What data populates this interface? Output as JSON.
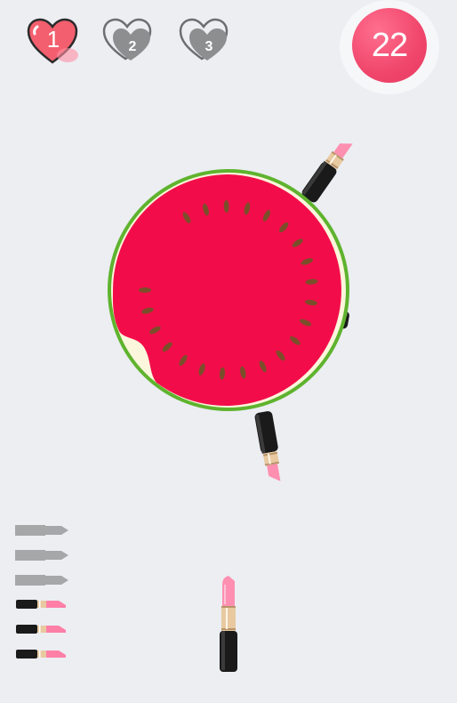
{
  "lives": [
    {
      "label": "1",
      "state": "active",
      "color": "#f35f6e"
    },
    {
      "label": "2",
      "state": "inactive",
      "color": "#8d8e90"
    },
    {
      "label": "3",
      "state": "inactive",
      "color": "#8d8e90"
    }
  ],
  "score": "22",
  "target": {
    "type": "watermelon-slice",
    "rind_color": "#5fb32e",
    "pith_color": "#fbf6dc",
    "flesh_color": "#f20d4a",
    "seed_color": "#7b4e2a",
    "seed_count": 22,
    "stuck_lipsticks": 3
  },
  "ammo": {
    "total": 6,
    "used": 3,
    "remaining": 3,
    "used_color": "#a6a7a9",
    "lipstick_color": "#ff7fa7"
  },
  "launcher": {
    "item": "lipstick",
    "tip_color": "#ff8fb0",
    "case_color": "#1a1a1a",
    "band_color": "#e8c9a0"
  }
}
